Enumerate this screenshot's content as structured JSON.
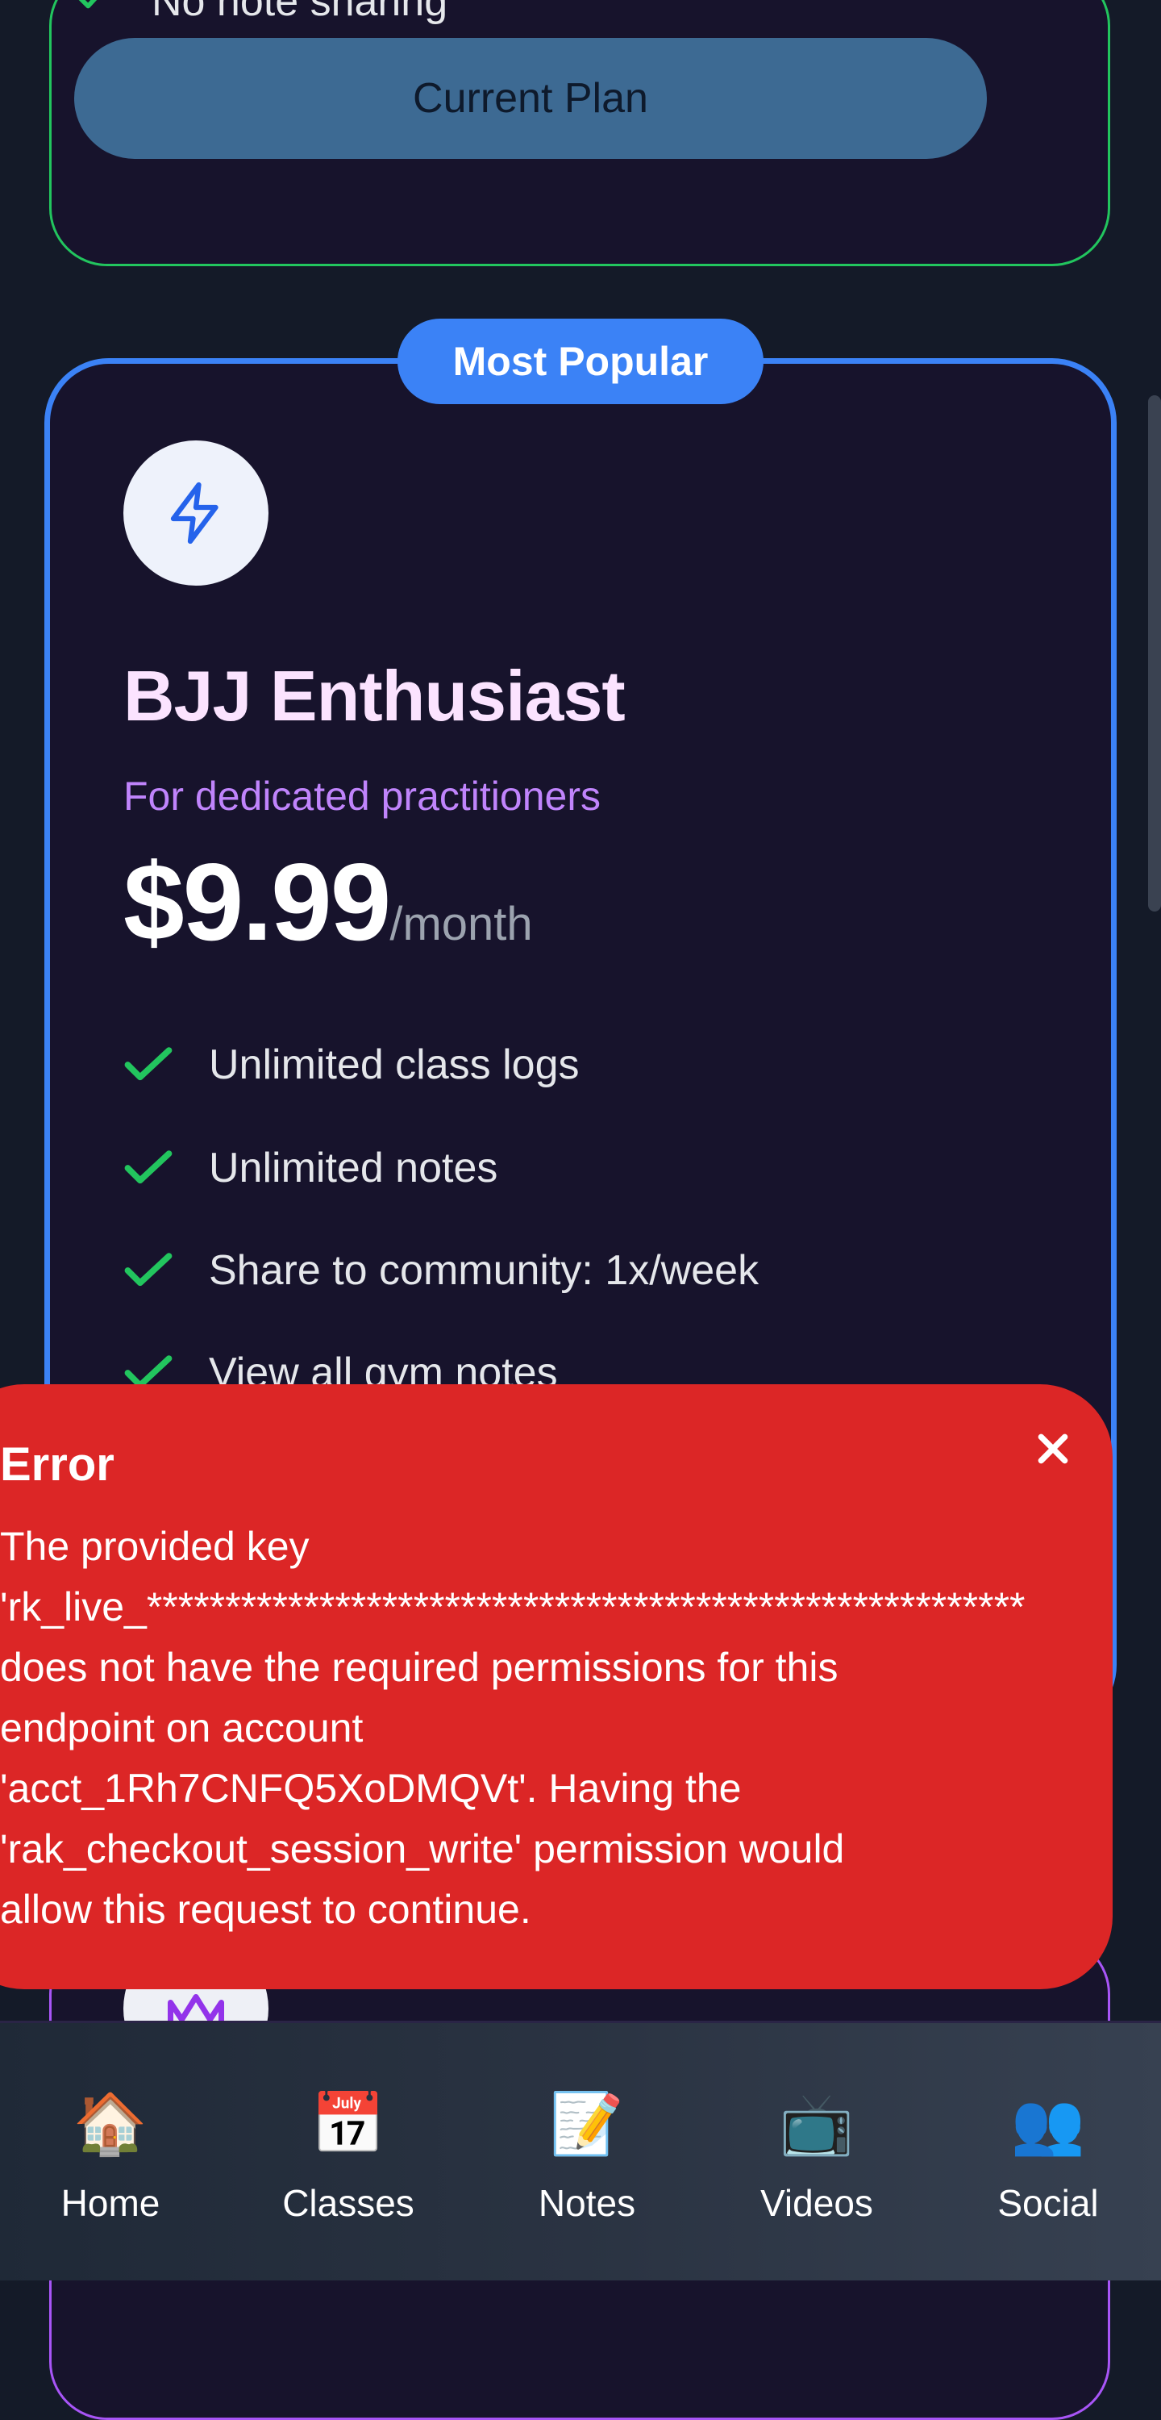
{
  "previous_plan": {
    "last_feature": "No note sharing",
    "button_label": "Current Plan"
  },
  "popular_plan": {
    "badge": "Most Popular",
    "icon": "lightning-icon",
    "title": "BJJ Enthusiast",
    "subtitle": "For dedicated practitioners",
    "price": "$9.99",
    "period": "/month",
    "features": [
      "Unlimited class logs",
      "Unlimited notes",
      "Share to community: 1x/week",
      "View all gym notes"
    ]
  },
  "next_plan": {
    "icon": "crown-icon"
  },
  "error": {
    "title": "Error",
    "lines": [
      "The provided key",
      "'rk_live_********************************************************",
      "does not have the required permissions for this",
      "endpoint on account",
      "'acct_1Rh7CNFQ5XoDMQVt'. Having the",
      "'rak_checkout_session_write' permission would",
      "allow this request to continue."
    ]
  },
  "nav": [
    {
      "icon": "🏠",
      "label": "Home"
    },
    {
      "icon": "📅",
      "label": "Classes"
    },
    {
      "icon": "📝",
      "label": "Notes"
    },
    {
      "icon": "📺",
      "label": "Videos"
    },
    {
      "icon": "👥",
      "label": "Social"
    }
  ],
  "colors": {
    "background": "#141a28",
    "card": "#17132c",
    "accent_blue": "#3b82f6",
    "accent_green": "#22c55e",
    "accent_purple": "#c084fc",
    "error_red": "#dc2626"
  }
}
